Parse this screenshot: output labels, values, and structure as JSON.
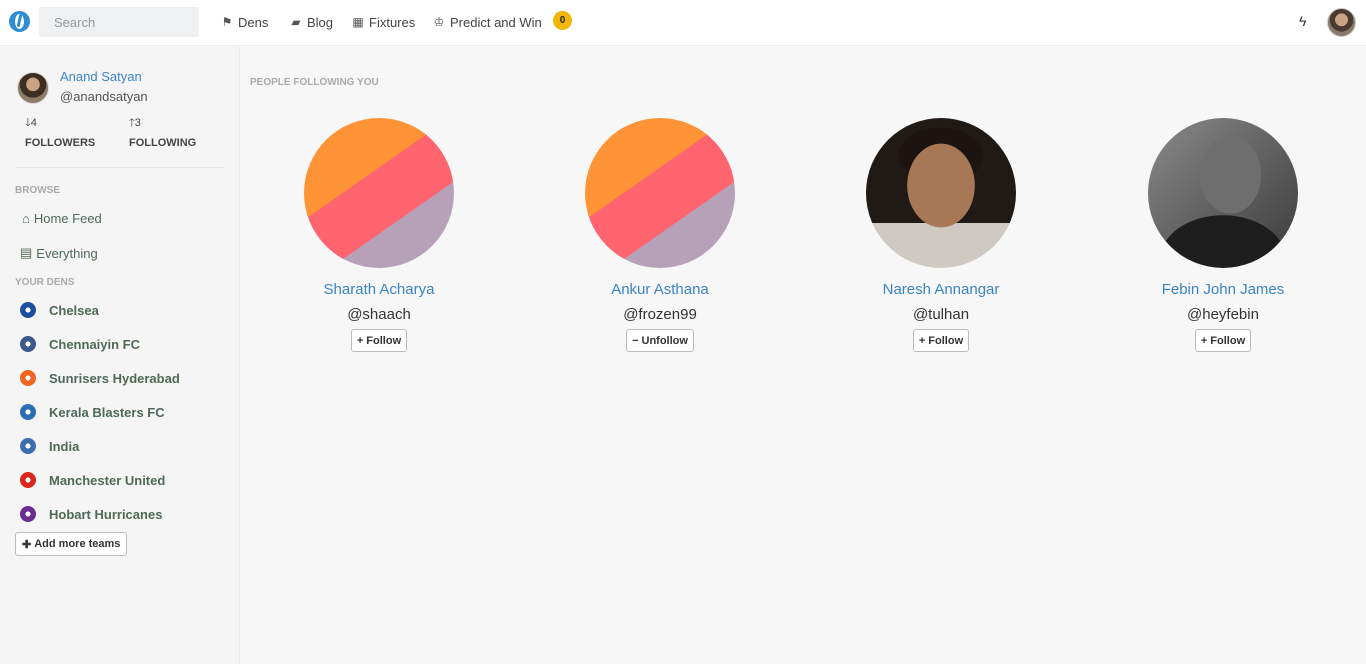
{
  "nav": {
    "search_placeholder": "Search",
    "items": [
      {
        "icon": "flag-icon",
        "glyph": "⚑",
        "label": "Dens"
      },
      {
        "icon": "book-icon",
        "glyph": "▰",
        "label": "Blog"
      },
      {
        "icon": "calendar-icon",
        "glyph": "▦",
        "label": "Fixtures"
      },
      {
        "icon": "trophy-icon",
        "glyph": "♔",
        "label": "Predict and Win"
      }
    ],
    "points": "0",
    "bolt_glyph": "ϟ"
  },
  "profile": {
    "name": "Anand Satyan",
    "handle": "@anandsatyan",
    "followers_count": "4",
    "followers_label": "FOLLOWERS",
    "following_count": "3",
    "following_label": "FOLLOWING"
  },
  "sidebar": {
    "browse_label": "BROWSE",
    "browse": [
      {
        "icon": "home-icon",
        "glyph": "⌂",
        "label": "Home Feed"
      },
      {
        "icon": "newspaper-icon",
        "glyph": "▤",
        "label": "Everything"
      }
    ],
    "dens_label": "YOUR DENS",
    "dens": [
      {
        "name": "Chelsea",
        "color": "#1d4fa0"
      },
      {
        "name": "Chennaiyin FC",
        "color": "#3a5a8c"
      },
      {
        "name": "Sunrisers Hyderabad",
        "color": "#f26522"
      },
      {
        "name": "Kerala Blasters FC",
        "color": "#2a6fb5"
      },
      {
        "name": "India",
        "color": "#3d6fb0"
      },
      {
        "name": "Manchester United",
        "color": "#da291c"
      },
      {
        "name": "Hobart Hurricanes",
        "color": "#6b2c91"
      }
    ],
    "add_teams_label": "Add more teams"
  },
  "main": {
    "title": "PEOPLE FOLLOWING YOU",
    "people": [
      {
        "name": "Sharath Acharya",
        "handle": "@shaach",
        "action": "Follow",
        "action_glyph": "+",
        "avatar": "def"
      },
      {
        "name": "Ankur Asthana",
        "handle": "@frozen99",
        "action": "Unfollow",
        "action_glyph": "−",
        "avatar": "def"
      },
      {
        "name": "Naresh Annangar",
        "handle": "@tulhan",
        "action": "Follow",
        "action_glyph": "+",
        "avatar": "naresh"
      },
      {
        "name": "Febin John James",
        "handle": "@heyfebin",
        "action": "Follow",
        "action_glyph": "+",
        "avatar": "febin"
      }
    ]
  }
}
